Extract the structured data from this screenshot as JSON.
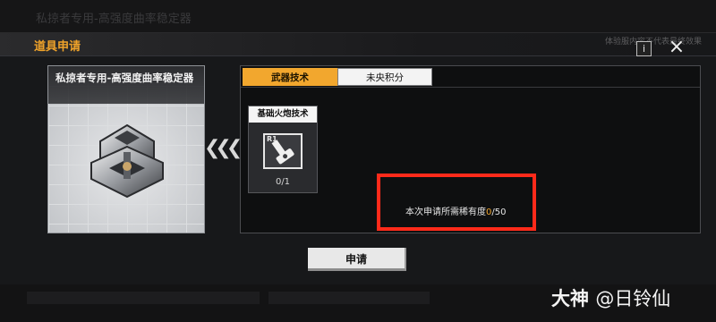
{
  "background": {
    "top_text": "私掠者专用-高强度曲率稳定器"
  },
  "header": {
    "title": "道具申请",
    "disclaimer": "体验服内容不代表最终效果",
    "info_label": "i",
    "close_label": "×"
  },
  "item": {
    "name": "私掠者专用-高强度曲率稳定器",
    "icon": "curvature-stabilizer"
  },
  "arrows_icon": "triple-chevron-left",
  "tabs": [
    {
      "label": "武器技术",
      "active": true
    },
    {
      "label": "未央积分",
      "active": false
    }
  ],
  "tech": {
    "title": "基础火炮技术",
    "rank": "R1",
    "icon": "cannon-tech-icon",
    "count": "0/1"
  },
  "requirement": {
    "label": "本次申请所需稀有度",
    "current": "0",
    "total": "/50"
  },
  "apply_label": "申请",
  "watermark": {
    "brand": "大神",
    "user": "@日铃仙"
  },
  "colors": {
    "accent": "#f2a72e",
    "highlight": "#ff2a1a"
  }
}
